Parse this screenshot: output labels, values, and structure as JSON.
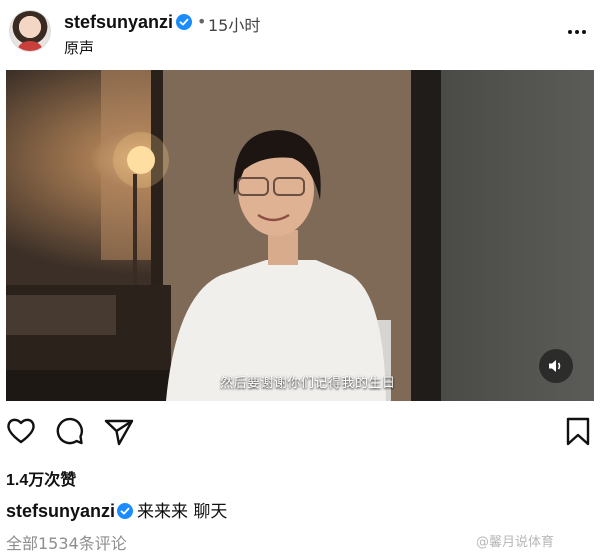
{
  "post": {
    "username": "stefsunyanzi",
    "separator": "•",
    "time": "15小时",
    "audio": "原声"
  },
  "media": {
    "subtitle": "然后要谢谢你们记得我的生日",
    "sound_icon": "speaker-icon"
  },
  "actions": {
    "icons": [
      "heart-icon",
      "comment-icon",
      "share-icon",
      "bookmark-icon"
    ]
  },
  "likes": "1.4万次赞",
  "caption": {
    "username": "stefsunyanzi",
    "text": "来来来 聊天"
  },
  "comments": "全部1534条评论",
  "watermark": "@馨月说体育",
  "colors": {
    "verified": "#1a8cff",
    "muted_text": "#8e8e8e"
  }
}
